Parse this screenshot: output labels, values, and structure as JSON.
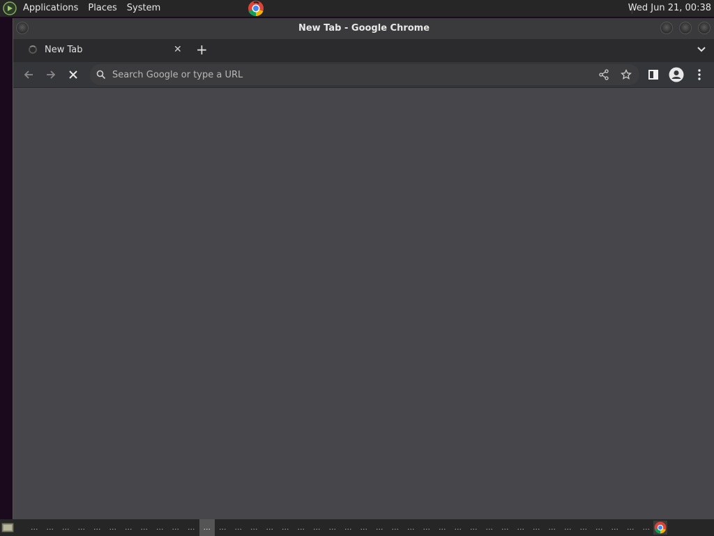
{
  "top_panel": {
    "menu": [
      {
        "label": "Applications"
      },
      {
        "label": "Places"
      },
      {
        "label": "System"
      }
    ],
    "clock": "Wed Jun 21, 00:38"
  },
  "window": {
    "title": "New Tab - Google Chrome"
  },
  "tabs": [
    {
      "title": "New Tab",
      "loading": true
    }
  ],
  "omnibox": {
    "placeholder": "Search Google or type a URL",
    "value": ""
  },
  "bottom_panel": {
    "workspaces": [
      "...",
      "...",
      "...",
      "...",
      "...",
      "...",
      "...",
      "...",
      "...",
      "...",
      "...",
      "...",
      "...",
      "...",
      "...",
      "...",
      "...",
      "...",
      "...",
      "...",
      "...",
      "...",
      "...",
      "...",
      "...",
      "...",
      "...",
      "...",
      "...",
      "...",
      "...",
      "...",
      "...",
      "...",
      "...",
      "...",
      "...",
      "...",
      "...",
      "...",
      "..."
    ],
    "active_workspace_index": 11
  },
  "colors": {
    "panel_bg": "#262626",
    "titlebar_bg": "#3a3a3c",
    "toolbar_bg": "#35363a",
    "content_bg": "#46464b",
    "desktop_bg": "#1a0b1c"
  },
  "icons": [
    "mate-menu-icon",
    "chrome-icon",
    "back-icon",
    "forward-icon",
    "stop-icon",
    "search-icon",
    "share-icon",
    "bookmark-star-icon",
    "side-panel-icon",
    "profile-icon",
    "kebab-menu-icon",
    "tab-search-icon",
    "show-desktop-icon"
  ]
}
